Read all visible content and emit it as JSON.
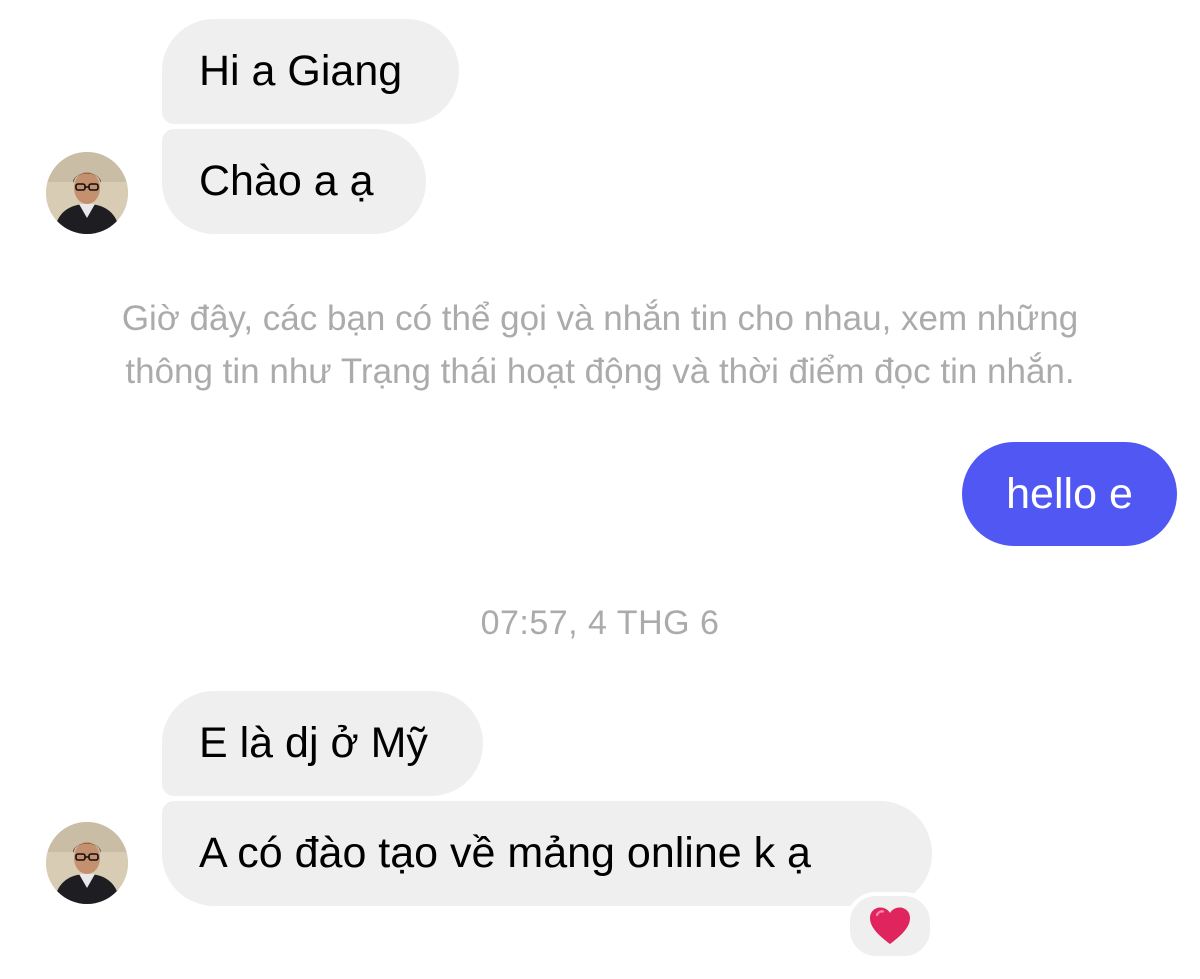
{
  "conversation": {
    "messages_group1": [
      {
        "text": "Hi a Giang"
      },
      {
        "text": "Chào a ạ"
      }
    ],
    "notice": {
      "line1": "Giờ đây, các bạn có thể gọi và nhắn tin cho nhau, xem những",
      "line2": "thông tin như Trạng thái hoạt động và thời điểm đọc tin nhắn."
    },
    "outgoing": {
      "text": "hello e"
    },
    "timestamp": "07:57, 4 THG 6",
    "messages_group2": [
      {
        "text": "E là dj ở Mỹ"
      },
      {
        "text": "A có đào tạo về mảng online k ạ",
        "reaction": "heart"
      }
    ]
  },
  "colors": {
    "incoming_bubble": "#efefef",
    "outgoing_bubble": "#5057f2",
    "meta_text": "#ababab",
    "heart": "#e0245e"
  },
  "icons": {
    "avatar": "contact-avatar-photo",
    "reaction": "red-heart-icon"
  }
}
